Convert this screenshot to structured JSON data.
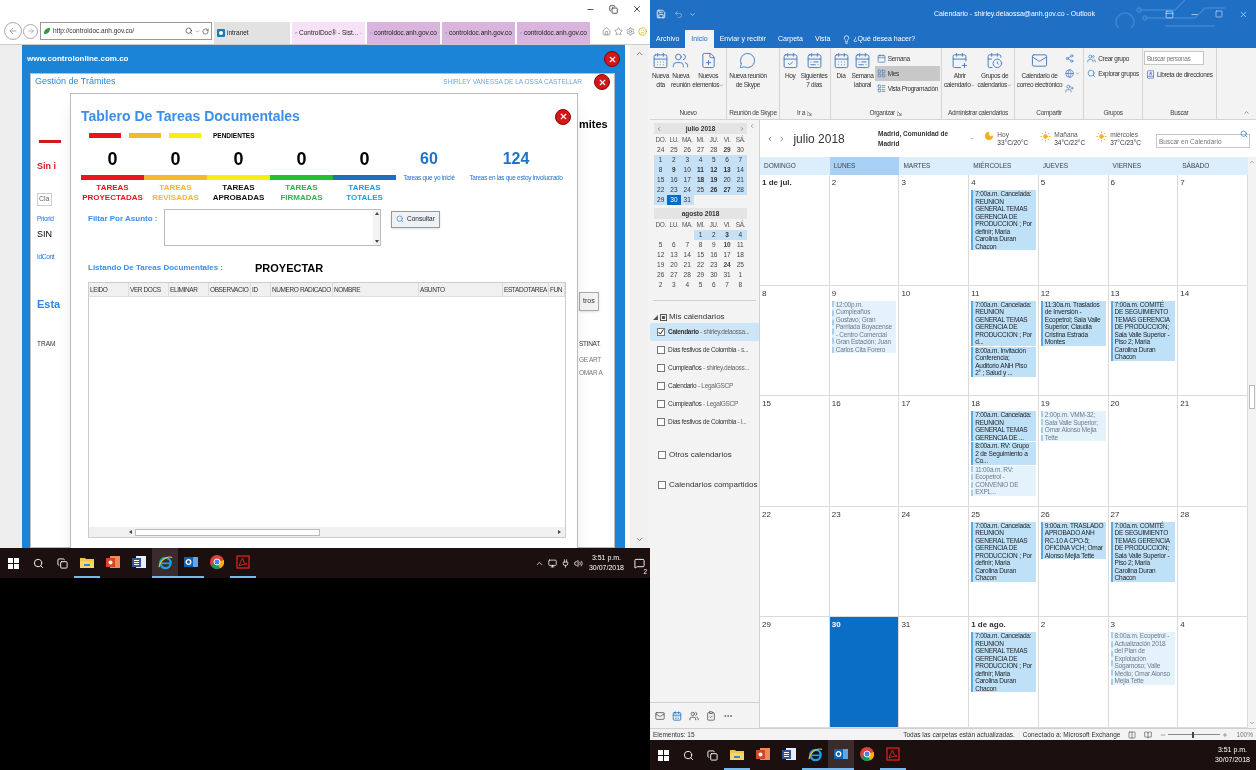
{
  "browser": {
    "address": "http://controldoc.anh.gov.co/",
    "tabs": [
      {
        "label": "intranet",
        "selected": false,
        "color": "#e2e2e2"
      },
      {
        "label": "ControlDoc® - Sist...",
        "selected": true,
        "color": "#f6e2f6"
      },
      {
        "label": "controldoc.anh.gov.co",
        "selected": false,
        "color": "#d9b4dc"
      },
      {
        "label": "controldoc.anh.gov.co",
        "selected": false,
        "color": "#d9b4dc"
      },
      {
        "label": "controldoc.anh.gov.co",
        "selected": false,
        "color": "#d9b4dc"
      }
    ]
  },
  "web_page": {
    "site": "www.controlonline.com.co",
    "title": "Gestión de Trámites",
    "user": "SHIRLEY VANESSA DE LA OSSA CASTELLAR",
    "left_fragments": [
      {
        "text": "Sin i",
        "kind": "alert"
      },
      {
        "text": "Cla",
        "kind": "field"
      },
      {
        "text": "Priorid",
        "kind": "label"
      },
      {
        "text": "SIN",
        "kind": "value"
      },
      {
        "text": "IdCont",
        "kind": "label"
      },
      {
        "text": "Esta",
        "kind": "heading"
      },
      {
        "text": "TRAM",
        "kind": "column"
      }
    ],
    "right_fragments": [
      {
        "text": "mites",
        "kind": "heading"
      },
      {
        "text": "tros",
        "kind": "button"
      },
      {
        "text": "STINAT.",
        "kind": "column"
      },
      {
        "text": "GE ART",
        "kind": "cell"
      },
      {
        "text": "OMAR A",
        "kind": "cell"
      }
    ]
  },
  "dialog": {
    "title": "Tablero De Tareas Documentales",
    "legend": {
      "label": "PENDIENTES",
      "items": [
        {
          "color": "#e8161b"
        },
        {
          "color": "#f5b731"
        },
        {
          "color": "#f7ef14"
        }
      ]
    },
    "counters": [
      {
        "count": "0",
        "bar": {
          "color": "#e8161b"
        },
        "label": {
          "text": "TAREAS PROYECTADAS",
          "color": "#e8161b"
        }
      },
      {
        "count": "0",
        "bar": {
          "color": "#f5b731"
        },
        "label": {
          "text": "TAREAS REVISADAS",
          "color": "#f5b731"
        }
      },
      {
        "count": "0",
        "bar": {
          "color": "#f7ef14"
        },
        "label": {
          "text": "TAREAS APROBADAS",
          "color": "#111111"
        }
      },
      {
        "count": "0",
        "bar": {
          "color": "#22c02a"
        },
        "label": {
          "text": "TAREAS FIRMADAS",
          "color": "#2fb34a"
        }
      },
      {
        "count": "0",
        "bar": {
          "color": "#1f6fbf"
        },
        "label": {
          "text": "TAREAS TOTALES",
          "color": "#1ba0e0"
        }
      }
    ],
    "stats": [
      {
        "count": "60",
        "label": "Tareas que yo inicié"
      },
      {
        "count": "124",
        "label": "Tareas en las que estoy involucrado"
      }
    ],
    "filter_label": "Filtar Por Asunto :",
    "button": "Consultar",
    "listing_label": "Listando De Tareas Documentales :",
    "listing_state": "PROYECTAR",
    "columns": [
      "LEIDO",
      "VER DOCS",
      "ELIMINAR",
      "OBSERVACIO",
      "ID",
      "NUMERO RADICADO",
      "NOMBRE",
      "ASUNTO",
      "ESTADOTAREA",
      "FUN"
    ]
  },
  "taskbar_left": {
    "apps": [
      {
        "kind": "explorer",
        "running": true,
        "active": false
      },
      {
        "kind": "powerpoint",
        "running": false,
        "active": false
      },
      {
        "kind": "word",
        "running": false,
        "active": false
      },
      {
        "kind": "ie",
        "running": true,
        "active": true
      },
      {
        "kind": "outlook",
        "running": true,
        "active": false
      },
      {
        "kind": "chrome",
        "running": false,
        "active": false
      },
      {
        "kind": "acrobat",
        "running": true,
        "active": false
      }
    ],
    "time": "3:51 p.m.",
    "date": "30/07/2018",
    "notifications": "2"
  },
  "outlook": {
    "title": "Calendario - shirley.delaossa@anh.gov.co  -  Outlook",
    "tabs": [
      {
        "label": "Archivo",
        "selected": false
      },
      {
        "label": "Inicio",
        "selected": true
      },
      {
        "label": "Enviar y recibir",
        "selected": false
      },
      {
        "label": "Carpeta",
        "selected": false
      },
      {
        "label": "Vista",
        "selected": false
      }
    ],
    "tell_me": "¿Qué desea hacer?",
    "ribbon": [
      {
        "label": "Nuevo",
        "launcher": false,
        "buttons": [
          {
            "kind": "large",
            "lines": [
              "Nueva",
              "cita"
            ],
            "menu": false
          },
          {
            "kind": "large",
            "lines": [
              "Nueva",
              "reunión"
            ],
            "menu": false
          },
          {
            "kind": "large",
            "lines": [
              "Nuevos",
              "elementos"
            ],
            "menu": true
          }
        ]
      },
      {
        "label": "Reunión de Skype",
        "launcher": false,
        "buttons": [
          {
            "kind": "large",
            "lines": [
              "Nueva reunión",
              "de Skype"
            ],
            "menu": false
          }
        ]
      },
      {
        "label": "Ir a",
        "launcher": true,
        "buttons": [
          {
            "kind": "large",
            "lines": [
              "Hoy"
            ],
            "menu": false
          },
          {
            "kind": "large",
            "lines": [
              "Siguientes",
              "7 días"
            ],
            "menu": false
          }
        ]
      },
      {
        "label": "Organizar",
        "launcher": true,
        "buttons": [
          {
            "kind": "large",
            "lines": [
              "Día"
            ],
            "menu": false,
            "selected": false
          },
          {
            "kind": "large",
            "lines": [
              "Semana",
              "laboral"
            ],
            "menu": false,
            "selected": false
          },
          {
            "kind": "small",
            "label": "Semana",
            "menu": false,
            "selected": false
          },
          {
            "kind": "small",
            "label": "Mes",
            "menu": false,
            "selected": true
          },
          {
            "kind": "small",
            "label": "Vista Programación",
            "menu": false,
            "selected": false
          }
        ]
      },
      {
        "label": "Administrar calendarios",
        "launcher": false,
        "buttons": [
          {
            "kind": "large",
            "lines": [
              "Abrir",
              "calendario"
            ],
            "menu": true
          },
          {
            "kind": "large",
            "lines": [
              "Grupos de",
              "calendarios"
            ],
            "menu": true
          }
        ]
      },
      {
        "label": "Compartir",
        "launcher": false,
        "buttons": [
          {
            "kind": "large",
            "lines": [
              "Calendario de",
              "correo electrónico"
            ],
            "menu": false
          },
          {
            "kind": "icon",
            "menu": false
          },
          {
            "kind": "icon",
            "menu": true
          },
          {
            "kind": "icon",
            "menu": false
          }
        ]
      },
      {
        "label": "Grupos",
        "launcher": false,
        "buttons": [
          {
            "kind": "small",
            "label": "Crear grupo",
            "menu": false
          },
          {
            "kind": "small",
            "label": "Explorar grupos",
            "menu": false
          }
        ]
      },
      {
        "label": "Buscar",
        "launcher": false,
        "buttons": [
          {
            "kind": "field",
            "placeholder": "Buscar personas"
          },
          {
            "kind": "small",
            "label": "Libreta de direcciones",
            "menu": false
          }
        ]
      }
    ],
    "mini_calendars": [
      {
        "title": "julio 2018",
        "arrows": true,
        "weekdays": [
          "DO.",
          "LU.",
          "MA.",
          "MI.",
          "JU.",
          "VI.",
          "SÁ."
        ],
        "weeks": [
          {
            "in_view": false,
            "days": [
              {
                "kind": "day",
                "d": "24",
                "bold": false,
                "selected": false
              },
              {
                "kind": "day",
                "d": "25",
                "bold": false,
                "selected": false
              },
              {
                "kind": "day",
                "d": "26",
                "bold": false,
                "selected": false
              },
              {
                "kind": "day",
                "d": "27",
                "bold": false,
                "selected": false
              },
              {
                "kind": "day",
                "d": "28",
                "bold": false,
                "selected": false
              },
              {
                "kind": "day",
                "d": "29",
                "bold": true,
                "selected": false
              },
              {
                "kind": "day",
                "d": "30",
                "bold": false,
                "selected": false
              }
            ]
          },
          {
            "in_view": true,
            "days": [
              {
                "kind": "day",
                "d": "1",
                "bold": false,
                "selected": false
              },
              {
                "kind": "day",
                "d": "2",
                "bold": false,
                "selected": false
              },
              {
                "kind": "day",
                "d": "3",
                "bold": false,
                "selected": false
              },
              {
                "kind": "day",
                "d": "4",
                "bold": false,
                "selected": false
              },
              {
                "kind": "day",
                "d": "5",
                "bold": false,
                "selected": false
              },
              {
                "kind": "day",
                "d": "6",
                "bold": false,
                "selected": false
              },
              {
                "kind": "day",
                "d": "7",
                "bold": false,
                "selected": false
              }
            ]
          },
          {
            "in_view": true,
            "days": [
              {
                "kind": "day",
                "d": "8",
                "bold": false,
                "selected": false
              },
              {
                "kind": "day",
                "d": "9",
                "bold": true,
                "selected": false
              },
              {
                "kind": "day",
                "d": "10",
                "bold": false,
                "selected": false
              },
              {
                "kind": "day",
                "d": "11",
                "bold": true,
                "selected": false
              },
              {
                "kind": "day",
                "d": "12",
                "bold": true,
                "selected": false
              },
              {
                "kind": "day",
                "d": "13",
                "bold": true,
                "selected": false
              },
              {
                "kind": "day",
                "d": "14",
                "bold": false,
                "selected": false
              }
            ]
          },
          {
            "in_view": true,
            "days": [
              {
                "kind": "day",
                "d": "15",
                "bold": false,
                "selected": false
              },
              {
                "kind": "day",
                "d": "16",
                "bold": false,
                "selected": false
              },
              {
                "kind": "day",
                "d": "17",
                "bold": false,
                "selected": false
              },
              {
                "kind": "day",
                "d": "18",
                "bold": true,
                "selected": false
              },
              {
                "kind": "day",
                "d": "19",
                "bold": true,
                "selected": false
              },
              {
                "kind": "day",
                "d": "20",
                "bold": false,
                "selected": false
              },
              {
                "kind": "day",
                "d": "21",
                "bold": false,
                "selected": false
              }
            ]
          },
          {
            "in_view": true,
            "days": [
              {
                "kind": "day",
                "d": "22",
                "bold": false,
                "selected": false
              },
              {
                "kind": "day",
                "d": "23",
                "bold": false,
                "selected": false
              },
              {
                "kind": "day",
                "d": "24",
                "bold": false,
                "selected": false
              },
              {
                "kind": "day",
                "d": "25",
                "bold": false,
                "selected": false
              },
              {
                "kind": "day",
                "d": "26",
                "bold": true,
                "selected": false
              },
              {
                "kind": "day",
                "d": "27",
                "bold": true,
                "selected": false
              },
              {
                "kind": "day",
                "d": "28",
                "bold": false,
                "selected": false
              }
            ]
          },
          {
            "in_view": true,
            "days": [
              {
                "kind": "day",
                "d": "29",
                "bold": false,
                "selected": false
              },
              {
                "kind": "day",
                "d": "30",
                "bold": false,
                "selected": true
              },
              {
                "kind": "day",
                "d": "31",
                "bold": false,
                "selected": false
              },
              {
                "kind": "blank"
              },
              {
                "kind": "blank"
              },
              {
                "kind": "blank"
              },
              {
                "kind": "blank"
              }
            ]
          }
        ]
      },
      {
        "title": "agosto 2018",
        "arrows": false,
        "weekdays": [
          "DO.",
          "LU.",
          "MA.",
          "MI.",
          "JU.",
          "VI.",
          "SÁ."
        ],
        "weeks": [
          {
            "in_view": true,
            "days": [
              {
                "kind": "blank"
              },
              {
                "kind": "blank"
              },
              {
                "kind": "blank"
              },
              {
                "kind": "day",
                "d": "1",
                "bold": false,
                "selected": false
              },
              {
                "kind": "day",
                "d": "2",
                "bold": false,
                "selected": false
              },
              {
                "kind": "day",
                "d": "3",
                "bold": true,
                "selected": false
              },
              {
                "kind": "day",
                "d": "4",
                "bold": false,
                "selected": false
              }
            ]
          },
          {
            "in_view": false,
            "days": [
              {
                "kind": "day",
                "d": "5",
                "bold": false,
                "selected": false
              },
              {
                "kind": "day",
                "d": "6",
                "bold": false,
                "selected": false
              },
              {
                "kind": "day",
                "d": "7",
                "bold": false,
                "selected": false
              },
              {
                "kind": "day",
                "d": "8",
                "bold": false,
                "selected": false
              },
              {
                "kind": "day",
                "d": "9",
                "bold": false,
                "selected": false
              },
              {
                "kind": "day",
                "d": "10",
                "bold": true,
                "selected": false
              },
              {
                "kind": "day",
                "d": "11",
                "bold": false,
                "selected": false
              }
            ]
          },
          {
            "in_view": false,
            "days": [
              {
                "kind": "day",
                "d": "12",
                "bold": false,
                "selected": false
              },
              {
                "kind": "day",
                "d": "13",
                "bold": false,
                "selected": false
              },
              {
                "kind": "day",
                "d": "14",
                "bold": false,
                "selected": false
              },
              {
                "kind": "day",
                "d": "15",
                "bold": false,
                "selected": false
              },
              {
                "kind": "day",
                "d": "16",
                "bold": false,
                "selected": false
              },
              {
                "kind": "day",
                "d": "17",
                "bold": false,
                "selected": false
              },
              {
                "kind": "day",
                "d": "18",
                "bold": false,
                "selected": false
              }
            ]
          },
          {
            "in_view": false,
            "days": [
              {
                "kind": "day",
                "d": "19",
                "bold": false,
                "selected": false
              },
              {
                "kind": "day",
                "d": "20",
                "bold": false,
                "selected": false
              },
              {
                "kind": "day",
                "d": "21",
                "bold": false,
                "selected": false
              },
              {
                "kind": "day",
                "d": "22",
                "bold": false,
                "selected": false
              },
              {
                "kind": "day",
                "d": "23",
                "bold": false,
                "selected": false
              },
              {
                "kind": "day",
                "d": "24",
                "bold": true,
                "selected": false
              },
              {
                "kind": "day",
                "d": "25",
                "bold": false,
                "selected": false
              }
            ]
          },
          {
            "in_view": false,
            "days": [
              {
                "kind": "day",
                "d": "26",
                "bold": false,
                "selected": false
              },
              {
                "kind": "day",
                "d": "27",
                "bold": false,
                "selected": false
              },
              {
                "kind": "day",
                "d": "28",
                "bold": false,
                "selected": false
              },
              {
                "kind": "day",
                "d": "29",
                "bold": false,
                "selected": false
              },
              {
                "kind": "day",
                "d": "30",
                "bold": false,
                "selected": false
              },
              {
                "kind": "day",
                "d": "31",
                "bold": false,
                "selected": false
              },
              {
                "kind": "day",
                "d": "1",
                "bold": false,
                "selected": false
              }
            ]
          },
          {
            "in_view": false,
            "days": [
              {
                "kind": "day",
                "d": "2",
                "bold": false,
                "selected": false
              },
              {
                "kind": "day",
                "d": "3",
                "bold": false,
                "selected": false
              },
              {
                "kind": "day",
                "d": "4",
                "bold": false,
                "selected": false
              },
              {
                "kind": "day",
                "d": "5",
                "bold": false,
                "selected": false
              },
              {
                "kind": "day",
                "d": "6",
                "bold": false,
                "selected": false
              },
              {
                "kind": "day",
                "d": "7",
                "bold": false,
                "selected": false
              },
              {
                "kind": "day",
                "d": "8",
                "bold": false,
                "selected": false
              }
            ]
          }
        ]
      }
    ],
    "my_calendars": {
      "label": "Mis calendarios",
      "expanded": true,
      "items": [
        {
          "name": "Calendario",
          "account": "- shirley.delaossa...",
          "checked": true,
          "selected": true
        },
        {
          "name": "Días festivos de Colombia",
          "account": "- s...",
          "checked": false,
          "selected": false
        },
        {
          "name": "Cumpleaños",
          "account": "- shirley.delaoss...",
          "checked": false,
          "selected": false
        },
        {
          "name": "Calendario",
          "account": "- LegalGSCP",
          "checked": false,
          "selected": false
        },
        {
          "name": "Cumpleaños",
          "account": "- LegalGSCP",
          "checked": false,
          "selected": false
        },
        {
          "name": "Días festivos de Colombia",
          "account": "- l...",
          "checked": false,
          "selected": false
        }
      ]
    },
    "other_groups": [
      {
        "label": "Otros calendarios",
        "checked": false
      },
      {
        "label": "Calendarios compartidos",
        "checked": false
      }
    ],
    "modules": [
      {
        "kind": "mail",
        "selected": false
      },
      {
        "kind": "calendar",
        "selected": true
      },
      {
        "kind": "people",
        "selected": false
      },
      {
        "kind": "tasks",
        "selected": false
      },
      {
        "kind": "more",
        "selected": false
      }
    ],
    "month": "julio 2018",
    "location": "Madrid, Comunidad de Madrid",
    "weather": [
      {
        "kind": "moon",
        "day": "Hoy",
        "temps": "33°C/20°C"
      },
      {
        "kind": "sun",
        "day": "Mañana",
        "temps": "34°C/22°C"
      },
      {
        "kind": "sun",
        "day": "miércoles",
        "temps": "37°C/23°C"
      }
    ],
    "search_placeholder": "Buscar en Calendario",
    "weekdays": [
      {
        "label": "DOMINGO",
        "selected": false
      },
      {
        "label": "LUNES",
        "selected": true
      },
      {
        "label": "MARTES",
        "selected": false
      },
      {
        "label": "MIÉRCOLES",
        "selected": false
      },
      {
        "label": "JUEVES",
        "selected": false
      },
      {
        "label": "VIERNES",
        "selected": false
      },
      {
        "label": "SÁBADO",
        "selected": false
      }
    ],
    "weeks": [
      [
        {
          "label": "1 de jul.",
          "bold": true,
          "today": false
        },
        {
          "label": "2",
          "bold": false,
          "today": false
        },
        {
          "label": "3",
          "bold": false,
          "today": false
        },
        {
          "label": "4",
          "bold": false,
          "today": false,
          "events": [
            {
              "kind": "busy",
              "text": "7:00a.m. Cancelada: REUNION GENERAL TEMAS GERENCIA DE PRODUCCION ; Por definir; Maria Carolina Duran Chacon"
            }
          ]
        },
        {
          "label": "5",
          "bold": false,
          "today": false
        },
        {
          "label": "6",
          "bold": false,
          "today": false
        },
        {
          "label": "7",
          "bold": false,
          "today": false
        }
      ],
      [
        {
          "label": "8",
          "bold": false,
          "today": false
        },
        {
          "label": "9",
          "bold": false,
          "today": false,
          "events": [
            {
              "kind": "tentative",
              "text": "12:00p.m. Cumpleaños Gustavo; Gran Parrilada Boyacense - Centro Comercial Gran Estación; Juan Carlos Cita Forero"
            }
          ]
        },
        {
          "label": "10",
          "bold": false,
          "today": false
        },
        {
          "label": "11",
          "bold": false,
          "today": false,
          "events": [
            {
              "kind": "busy",
              "text": "7:00a.m. Cancelada: REUNION GENERAL TEMAS GERENCIA DE PRODUCCION ; Por d..."
            },
            {
              "kind": "busy",
              "text": "8:00a.m. Invitación Conferencia; Auditorio ANH Piso 2° ; Salud y ..."
            }
          ]
        },
        {
          "label": "12",
          "bold": false,
          "today": false,
          "events": [
            {
              "kind": "busy",
              "text": "11:30a.m. Traslados de Inversión - Ecopetrol; Sala Valle Superior; Claudia Cristina Estrada Montes"
            }
          ]
        },
        {
          "label": "13",
          "bold": false,
          "today": false,
          "events": [
            {
              "kind": "busy",
              "text": "7:00a.m. COMITÉ DE SEGUIMIENTO TEMAS GERENCIA DE PRODUCCION; Sala Valle Superior - Piso 2; Maria Carolina Duran Chacon"
            }
          ]
        },
        {
          "label": "14",
          "bold": false,
          "today": false
        }
      ],
      [
        {
          "label": "15",
          "bold": false,
          "today": false
        },
        {
          "label": "16",
          "bold": false,
          "today": false
        },
        {
          "label": "17",
          "bold": false,
          "today": false
        },
        {
          "label": "18",
          "bold": false,
          "today": false,
          "events": [
            {
              "kind": "busy",
              "text": "7:00a.m. Cancelada: REUNION GENERAL TEMAS GERENCIA DE ..."
            },
            {
              "kind": "busy",
              "text": "8:00a.m. RV: Grupo 2 de Seguimiento a Co..."
            },
            {
              "kind": "tentative",
              "text": "11:00a.m. RV: Ecopetrol - CONVENIO DE EXPL..."
            }
          ]
        },
        {
          "label": "19",
          "bold": false,
          "today": false,
          "events": [
            {
              "kind": "tentative",
              "text": "2:00p.m. VMM-32; Sala Valle Superior; Omar Alonso Mejia Tette"
            }
          ]
        },
        {
          "label": "20",
          "bold": false,
          "today": false
        },
        {
          "label": "21",
          "bold": false,
          "today": false
        }
      ],
      [
        {
          "label": "22",
          "bold": false,
          "today": false
        },
        {
          "label": "23",
          "bold": false,
          "today": false
        },
        {
          "label": "24",
          "bold": false,
          "today": false
        },
        {
          "label": "25",
          "bold": false,
          "today": false,
          "events": [
            {
              "kind": "busy",
              "text": "7:00a.m. Cancelada: REUNION GENERAL TEMAS GERENCIA DE PRODUCCION ; Por definir; Maria Carolina Duran Chacon"
            }
          ]
        },
        {
          "label": "26",
          "bold": false,
          "today": false,
          "events": [
            {
              "kind": "busy",
              "text": "9:00a.m. TRASLADO APROBADO ANH RC-10 A CPO-5; OFICINA VCH; Omar Alonso Mejia Tette"
            }
          ]
        },
        {
          "label": "27",
          "bold": false,
          "today": false,
          "events": [
            {
              "kind": "busy",
              "text": "7:00a.m. COMITÉ DE SEGUIMIENTO TEMAS GERENCIA DE PRODUCCION; Sala Valle Superior - Piso 2; Maria Carolina Duran Chacon"
            }
          ]
        },
        {
          "label": "28",
          "bold": false,
          "today": false
        }
      ],
      [
        {
          "label": "29",
          "bold": false,
          "today": false
        },
        {
          "label": "30",
          "bold": true,
          "today": true
        },
        {
          "label": "31",
          "bold": false,
          "today": false
        },
        {
          "label": "1 de ago.",
          "bold": true,
          "today": false,
          "events": [
            {
              "kind": "busy",
              "text": "7:00a.m. Cancelada: REUNION GENERAL TEMAS GERENCIA DE PRODUCCION ; Por definir; Maria Carolina Duran Chacon"
            }
          ]
        },
        {
          "label": "2",
          "bold": false,
          "today": false
        },
        {
          "label": "3",
          "bold": false,
          "today": false,
          "events": [
            {
              "kind": "tentative",
              "text": "8:00a.m. Ecopetrol - Actualización 2018 del Plan de Explotación Sogamoso; Valle Medio; Omar Alonso Mejia Tette"
            }
          ]
        },
        {
          "label": "4",
          "bold": false,
          "today": false
        }
      ]
    ],
    "status": {
      "items": "Elementos: 15",
      "sync": "Todas las carpetas están actualizadas.",
      "connection": "Conectado a: Microsoft Exchange",
      "zoom": {
        "level": 0.45,
        "reading": "100%"
      }
    }
  },
  "taskbar_right": {
    "apps": [
      {
        "kind": "explorer",
        "running": true,
        "active": false
      },
      {
        "kind": "powerpoint",
        "running": false,
        "active": false
      },
      {
        "kind": "word",
        "running": false,
        "active": false
      },
      {
        "kind": "ie",
        "running": true,
        "active": false
      },
      {
        "kind": "outlook",
        "running": true,
        "active": true
      },
      {
        "kind": "chrome",
        "running": false,
        "active": false
      },
      {
        "kind": "acrobat",
        "running": true,
        "active": false
      }
    ],
    "time": "3:51 p.m.",
    "date": "30/07/2018"
  }
}
